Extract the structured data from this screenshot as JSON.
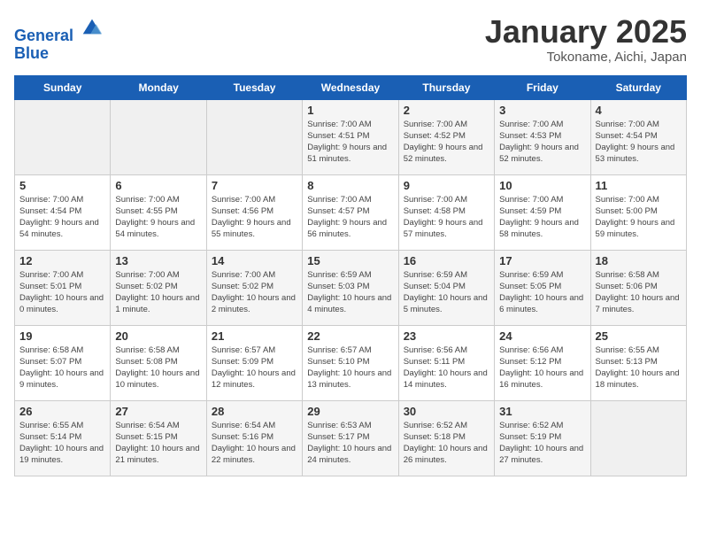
{
  "header": {
    "logo_line1": "General",
    "logo_line2": "Blue",
    "title": "January 2025",
    "subtitle": "Tokoname, Aichi, Japan"
  },
  "days_of_week": [
    "Sunday",
    "Monday",
    "Tuesday",
    "Wednesday",
    "Thursday",
    "Friday",
    "Saturday"
  ],
  "weeks": [
    [
      {
        "day": "",
        "info": ""
      },
      {
        "day": "",
        "info": ""
      },
      {
        "day": "",
        "info": ""
      },
      {
        "day": "1",
        "info": "Sunrise: 7:00 AM\nSunset: 4:51 PM\nDaylight: 9 hours\nand 51 minutes."
      },
      {
        "day": "2",
        "info": "Sunrise: 7:00 AM\nSunset: 4:52 PM\nDaylight: 9 hours\nand 52 minutes."
      },
      {
        "day": "3",
        "info": "Sunrise: 7:00 AM\nSunset: 4:53 PM\nDaylight: 9 hours\nand 52 minutes."
      },
      {
        "day": "4",
        "info": "Sunrise: 7:00 AM\nSunset: 4:54 PM\nDaylight: 9 hours\nand 53 minutes."
      }
    ],
    [
      {
        "day": "5",
        "info": "Sunrise: 7:00 AM\nSunset: 4:54 PM\nDaylight: 9 hours\nand 54 minutes."
      },
      {
        "day": "6",
        "info": "Sunrise: 7:00 AM\nSunset: 4:55 PM\nDaylight: 9 hours\nand 54 minutes."
      },
      {
        "day": "7",
        "info": "Sunrise: 7:00 AM\nSunset: 4:56 PM\nDaylight: 9 hours\nand 55 minutes."
      },
      {
        "day": "8",
        "info": "Sunrise: 7:00 AM\nSunset: 4:57 PM\nDaylight: 9 hours\nand 56 minutes."
      },
      {
        "day": "9",
        "info": "Sunrise: 7:00 AM\nSunset: 4:58 PM\nDaylight: 9 hours\nand 57 minutes."
      },
      {
        "day": "10",
        "info": "Sunrise: 7:00 AM\nSunset: 4:59 PM\nDaylight: 9 hours\nand 58 minutes."
      },
      {
        "day": "11",
        "info": "Sunrise: 7:00 AM\nSunset: 5:00 PM\nDaylight: 9 hours\nand 59 minutes."
      }
    ],
    [
      {
        "day": "12",
        "info": "Sunrise: 7:00 AM\nSunset: 5:01 PM\nDaylight: 10 hours\nand 0 minutes."
      },
      {
        "day": "13",
        "info": "Sunrise: 7:00 AM\nSunset: 5:02 PM\nDaylight: 10 hours\nand 1 minute."
      },
      {
        "day": "14",
        "info": "Sunrise: 7:00 AM\nSunset: 5:02 PM\nDaylight: 10 hours\nand 2 minutes."
      },
      {
        "day": "15",
        "info": "Sunrise: 6:59 AM\nSunset: 5:03 PM\nDaylight: 10 hours\nand 4 minutes."
      },
      {
        "day": "16",
        "info": "Sunrise: 6:59 AM\nSunset: 5:04 PM\nDaylight: 10 hours\nand 5 minutes."
      },
      {
        "day": "17",
        "info": "Sunrise: 6:59 AM\nSunset: 5:05 PM\nDaylight: 10 hours\nand 6 minutes."
      },
      {
        "day": "18",
        "info": "Sunrise: 6:58 AM\nSunset: 5:06 PM\nDaylight: 10 hours\nand 7 minutes."
      }
    ],
    [
      {
        "day": "19",
        "info": "Sunrise: 6:58 AM\nSunset: 5:07 PM\nDaylight: 10 hours\nand 9 minutes."
      },
      {
        "day": "20",
        "info": "Sunrise: 6:58 AM\nSunset: 5:08 PM\nDaylight: 10 hours\nand 10 minutes."
      },
      {
        "day": "21",
        "info": "Sunrise: 6:57 AM\nSunset: 5:09 PM\nDaylight: 10 hours\nand 12 minutes."
      },
      {
        "day": "22",
        "info": "Sunrise: 6:57 AM\nSunset: 5:10 PM\nDaylight: 10 hours\nand 13 minutes."
      },
      {
        "day": "23",
        "info": "Sunrise: 6:56 AM\nSunset: 5:11 PM\nDaylight: 10 hours\nand 14 minutes."
      },
      {
        "day": "24",
        "info": "Sunrise: 6:56 AM\nSunset: 5:12 PM\nDaylight: 10 hours\nand 16 minutes."
      },
      {
        "day": "25",
        "info": "Sunrise: 6:55 AM\nSunset: 5:13 PM\nDaylight: 10 hours\nand 18 minutes."
      }
    ],
    [
      {
        "day": "26",
        "info": "Sunrise: 6:55 AM\nSunset: 5:14 PM\nDaylight: 10 hours\nand 19 minutes."
      },
      {
        "day": "27",
        "info": "Sunrise: 6:54 AM\nSunset: 5:15 PM\nDaylight: 10 hours\nand 21 minutes."
      },
      {
        "day": "28",
        "info": "Sunrise: 6:54 AM\nSunset: 5:16 PM\nDaylight: 10 hours\nand 22 minutes."
      },
      {
        "day": "29",
        "info": "Sunrise: 6:53 AM\nSunset: 5:17 PM\nDaylight: 10 hours\nand 24 minutes."
      },
      {
        "day": "30",
        "info": "Sunrise: 6:52 AM\nSunset: 5:18 PM\nDaylight: 10 hours\nand 26 minutes."
      },
      {
        "day": "31",
        "info": "Sunrise: 6:52 AM\nSunset: 5:19 PM\nDaylight: 10 hours\nand 27 minutes."
      },
      {
        "day": "",
        "info": ""
      }
    ]
  ]
}
